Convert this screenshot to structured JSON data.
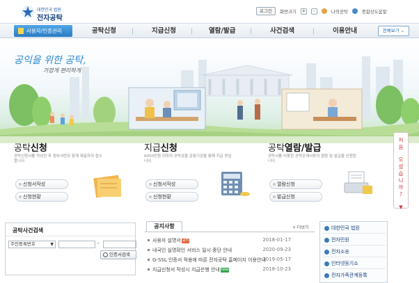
{
  "header": {
    "logo_sub": "대한민국 법원",
    "logo_main": "전자공탁",
    "login": "로그인",
    "zoom_label": "화면크기",
    "zoom_plus": "+",
    "zoom_minus": "-",
    "my_deposit": "나의공탁",
    "family_sites": "종합상도움말"
  },
  "nav": {
    "cert_label": "사용자/인증관리",
    "items": [
      "공탁신청",
      "지급신청",
      "열람/발급",
      "사건검색",
      "이용안내"
    ],
    "all_view": "전체보기 ⌄"
  },
  "hero": {
    "tagline1": "공익을 위한 공탁,",
    "tagline2": "가깝게 편리하게"
  },
  "side_banner": {
    "text": [
      "처",
      "음",
      "오",
      "셨",
      "습",
      "니",
      "까",
      "?"
    ]
  },
  "panels": [
    {
      "title_plain": "공탁",
      "title_bold": "신청",
      "desc": "공탁신청서를 작성한 후 첨부서면과 함께 제출하여 접수합니다.",
      "buttons": [
        "신청서작성",
        "신청현황"
      ]
    },
    {
      "title_plain": "지급",
      "title_bold": "신청",
      "desc": "6000만원 이하의 공탁금을 금융기관을 통해 지급 받습니다.",
      "buttons": [
        "신청서작성",
        "신청현황"
      ]
    },
    {
      "title_plain": "공탁",
      "title_bold": "열람/발급",
      "desc": "공탁서를 비롯한 공탁관계서류의 열람 및 발급을 신청합니다.",
      "buttons": [
        "열람신청",
        "발급신청"
      ]
    }
  ],
  "search": {
    "title": "공탁사건검색",
    "select_value": "주민등록번호",
    "dash": "-",
    "button": "인증서검색"
  },
  "notice": {
    "tab": "공지사항",
    "more": "+ 더보기",
    "items": [
      {
        "title": "사용자 설명서",
        "tag": "공지",
        "tag_color": "#e0643a",
        "date": "2018-01-17"
      },
      {
        "title": "내국인 실명확인 서비스 일시 중단 안내",
        "tag": "",
        "tag_color": "",
        "date": "2020-09-23"
      },
      {
        "title": "G-SSL 인증서 적용에 따른 전자공탁 홈페이지 이용안내",
        "tag": "",
        "tag_color": "",
        "date": "2019-05-17"
      },
      {
        "title": "지급신청서 작성시 지급은행 안내",
        "tag": "new",
        "tag_color": "#3aa655",
        "date": "2018-10-23"
      }
    ]
  },
  "quick_links": [
    "대한민국 법원",
    "전자민원",
    "전자소송",
    "인터넷등기소",
    "전자가족관계등록"
  ]
}
